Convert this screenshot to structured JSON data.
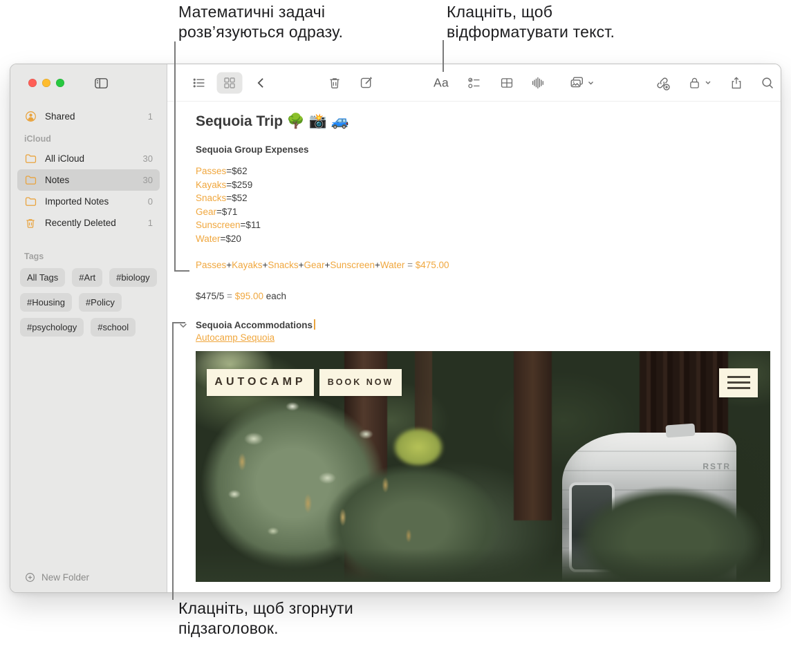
{
  "callouts": {
    "math": {
      "line1": "Математичні задачі",
      "line2": "розв’язуються одразу."
    },
    "format": {
      "line1": "Клацніть, щоб",
      "line2": "відформатувати текст."
    },
    "collapse": {
      "line1": "Клацніть, щоб згорнути",
      "line2": "підзаголовок."
    }
  },
  "toolbar": {
    "format_label": "Aa",
    "icons": [
      "list-view",
      "gallery-view",
      "back",
      "delete-note",
      "new-note",
      "format-text",
      "checklist",
      "table",
      "audio-recording",
      "media",
      "add-link",
      "lock",
      "share",
      "search"
    ]
  },
  "sidebar": {
    "shared": {
      "label": "Shared",
      "count": "1"
    },
    "sections": {
      "icloud": "iCloud",
      "tags": "Tags"
    },
    "folders": [
      {
        "label": "All iCloud",
        "count": "30"
      },
      {
        "label": "Notes",
        "count": "30"
      },
      {
        "label": "Imported Notes",
        "count": "0"
      },
      {
        "label": "Recently Deleted",
        "count": "1"
      }
    ],
    "tags": [
      "All Tags",
      "#Art",
      "#biology",
      "#Housing",
      "#Policy",
      "#psychology",
      "#school"
    ],
    "new_folder": "New Folder"
  },
  "note": {
    "title": "Sequoia Trip 🌳 📸 🚙",
    "subtitle": "Sequoia Group Expenses",
    "expenses": [
      {
        "name": "Passes",
        "amount": "=$62"
      },
      {
        "name": "Kayaks",
        "amount": "=$259"
      },
      {
        "name": "Snacks",
        "amount": "=$52"
      },
      {
        "name": "Gear",
        "amount": "=$71"
      },
      {
        "name": "Sunscreen",
        "amount": "=$11"
      },
      {
        "name": "Water",
        "amount": "=$20"
      }
    ],
    "formula": {
      "t0": "Passes",
      "t1": "Kayaks",
      "t2": "Snacks",
      "t3": "Gear",
      "t4": "Sunscreen",
      "t5": "Water",
      "plus": "+",
      "eq": " = ",
      "result": "$475.00"
    },
    "division": {
      "lhs": "$475/5",
      "eq": " = ",
      "result": "$95.00",
      "suffix": " each"
    },
    "section_title": "Sequoia Accommodations",
    "link": "Autocamp Sequoia"
  },
  "photo": {
    "brand": "AUTOCAMP",
    "cta": "BOOK NOW",
    "trailer_text": "RSTR"
  },
  "colors": {
    "accent_orange": "#E9A33D",
    "selected_gray": "#D2D2D1",
    "traffic_red": "#FF5F57",
    "traffic_yellow": "#FEBC2E",
    "traffic_green": "#28C840"
  }
}
